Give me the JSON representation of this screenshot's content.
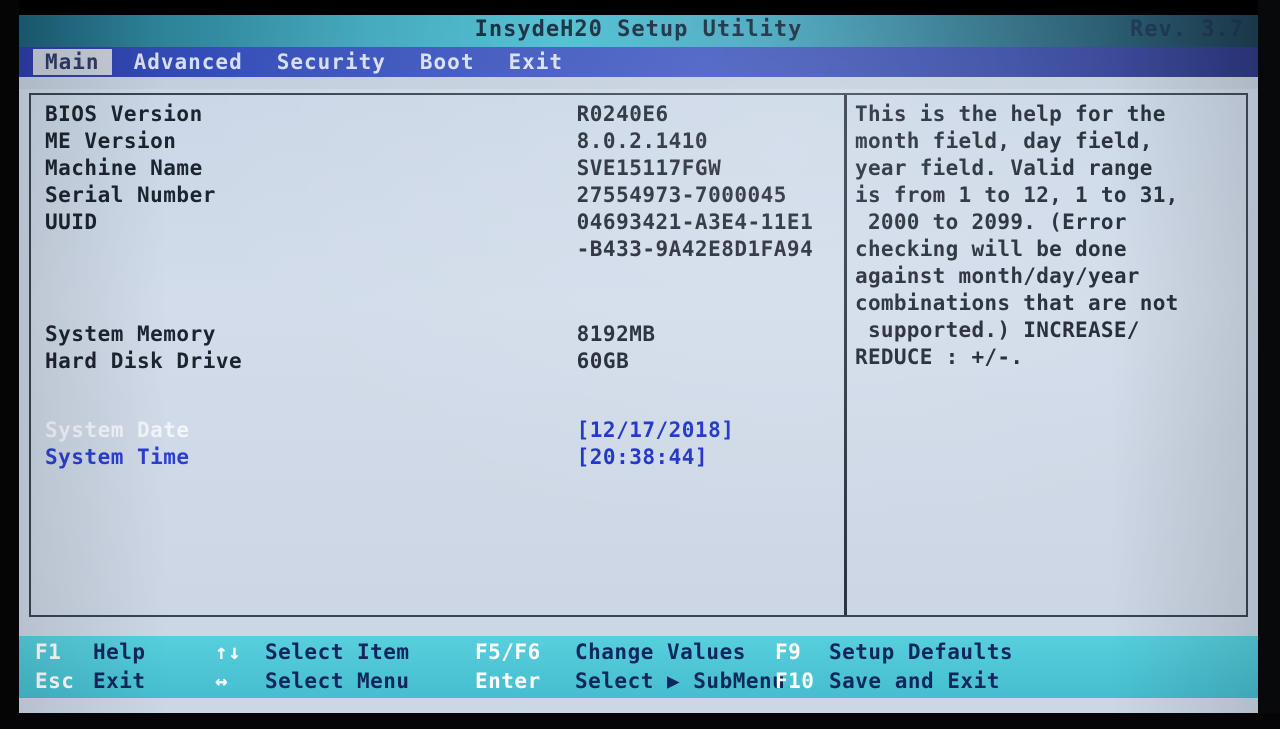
{
  "titlebar": {
    "title": "InsydeH20 Setup Utility",
    "revision": "Rev. 3.7"
  },
  "menu": {
    "items": [
      {
        "label": "Main",
        "active": true
      },
      {
        "label": "Advanced",
        "active": false
      },
      {
        "label": "Security",
        "active": false
      },
      {
        "label": "Boot",
        "active": false
      },
      {
        "label": "Exit",
        "active": false
      }
    ]
  },
  "main": {
    "info_rows": [
      {
        "label": "BIOS Version",
        "value": "R0240E6"
      },
      {
        "label": "ME Version",
        "value": "8.0.2.1410"
      },
      {
        "label": "Machine Name",
        "value": "SVE15117FGW"
      },
      {
        "label": "Serial Number",
        "value": "27554973-7000045"
      },
      {
        "label": "UUID",
        "value": "04693421-A3E4-11E1"
      },
      {
        "label": "",
        "value": "-B433-9A42E8D1FA94"
      }
    ],
    "hardware_rows": [
      {
        "label": "System Memory",
        "value": "8192MB"
      },
      {
        "label": "Hard Disk Drive",
        "value": "60GB"
      }
    ],
    "datetime_rows": [
      {
        "label": "System Date",
        "value": "[12/17/2018]",
        "selected": true
      },
      {
        "label": "System Time",
        "value": "[20:38:44]",
        "selected": false
      }
    ]
  },
  "help": {
    "lines": [
      "This is the help for the",
      "month field, day field,",
      "year field. Valid range",
      "is from 1 to 12, 1 to 31,",
      " 2000 to 2099. (Error",
      "checking will be done",
      "against month/day/year",
      "combinations that are not",
      " supported.) INCREASE/",
      "REDUCE : +/-."
    ]
  },
  "footer": {
    "columns": [
      {
        "rows": [
          {
            "key": "F1",
            "desc": "Help"
          },
          {
            "key": "Esc",
            "desc": "Exit"
          }
        ]
      },
      {
        "rows": [
          {
            "key": "↑↓",
            "desc": "Select Item"
          },
          {
            "key": "↔",
            "desc": "Select Menu"
          }
        ]
      },
      {
        "rows": [
          {
            "key": "F5/F6",
            "desc": "Change Values"
          },
          {
            "key": "Enter",
            "desc": "Select ▶ SubMenu"
          }
        ]
      },
      {
        "rows": [
          {
            "key": "F9",
            "desc": "Setup Defaults"
          },
          {
            "key": "F10",
            "desc": "Save and Exit"
          }
        ]
      }
    ]
  },
  "colors": {
    "titlebar_accent": "#46bcd0",
    "menubar": "#3550bb",
    "body_bg": "#ccd7e6",
    "footer_bg": "#4ec6d6",
    "selected_value": "#1b31c8",
    "text": "#1c2430"
  }
}
